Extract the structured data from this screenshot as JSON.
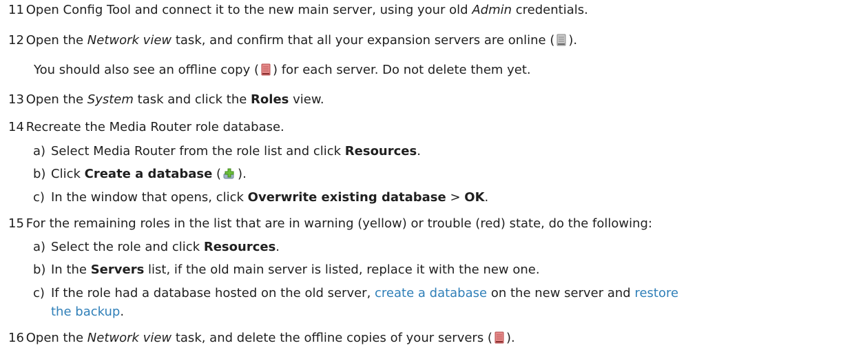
{
  "steps": [
    {
      "num": "11",
      "t1": "Open Config Tool and connect it to the new main server, using your old ",
      "t1_em": "Admin",
      "t1_end": " credentials."
    },
    {
      "num": "12",
      "t1": "Open the ",
      "t1_em": "Network view",
      "t1_mid": " task, and confirm that all your expansion servers are online (",
      "t1_end": ").",
      "note_a": "You should also see an offline copy (",
      "note_b": ") for each server. Do not delete them yet."
    },
    {
      "num": "13",
      "t1": "Open the ",
      "t1_em": "System",
      "t1_mid": " task and click the ",
      "t1_b": "Roles",
      "t1_end": " view."
    },
    {
      "num": "14",
      "t1": "Recreate the Media Router role database.",
      "subs": [
        {
          "letter": "a)",
          "t1": "Select Media Router from the role list and click ",
          "t1_b": "Resources",
          "t1_end": "."
        },
        {
          "letter": "b)",
          "t1": "Click ",
          "t1_b": "Create a database",
          "t1_mid": " (",
          "t1_end": ")."
        },
        {
          "letter": "c)",
          "t1": "In the window that opens, click ",
          "t1_b": "Overwrite existing database",
          "t1_mid": " > ",
          "t1_b2": "OK",
          "t1_end": "."
        }
      ]
    },
    {
      "num": "15",
      "t1": "For the remaining roles in the list that are in warning (yellow) or trouble (red) state, do the following:",
      "subs": [
        {
          "letter": "a)",
          "t1": "Select the role and click ",
          "t1_b": "Resources",
          "t1_end": "."
        },
        {
          "letter": "b)",
          "t1": "In the ",
          "t1_b": "Servers",
          "t1_end": " list, if the old main server is listed, replace it with the new one."
        },
        {
          "letter": "c)",
          "t1": "If the role had a database hosted on the old server, ",
          "link1": "create a database",
          "t1_mid": " on the new server and ",
          "link2a": "restore",
          "link2b": "the backup",
          "t1_end": "."
        }
      ]
    },
    {
      "num": "16",
      "t1": "Open the ",
      "t1_em": "Network view",
      "t1_mid": " task, and delete the offline copies of your servers (",
      "t1_end": ")."
    }
  ],
  "icons": {
    "server_online": "server-online-icon",
    "server_offline": "server-offline-icon",
    "create_db": "plus-icon"
  },
  "colors": {
    "link": "#2f7fb8",
    "offline_red": "#e07070",
    "online_gray": "#b8b8b8",
    "plus_green": "#6cbf3a"
  }
}
